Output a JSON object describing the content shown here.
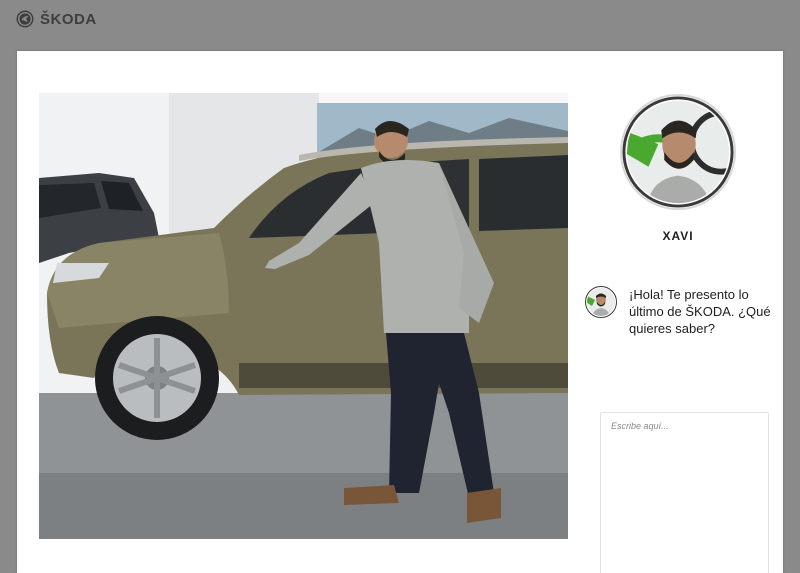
{
  "brand": {
    "name": "ŠKODA",
    "logo_icon": "skoda-winged-arrow-icon",
    "color": "#3e3e3e"
  },
  "photo": {
    "description_icon": "showroom-photo"
  },
  "agent": {
    "name": "XAVI",
    "avatar_icon": "agent-avatar"
  },
  "chat": {
    "greeting": "¡Hola! Te presento lo último de ŠKODA. ¿Qué quieres saber?",
    "input_placeholder": "Escribe aquí..."
  },
  "colors": {
    "page_background": "#8a8a8a",
    "card_background": "#ffffff",
    "brand_green": "#4ba82e"
  }
}
